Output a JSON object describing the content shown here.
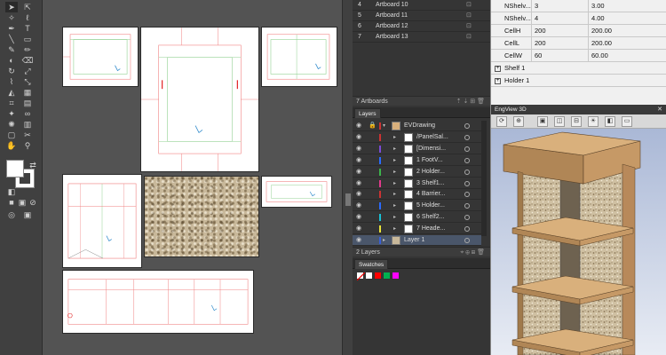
{
  "tools": {
    "icons": [
      "selection-arrow",
      "direct-select-arrow",
      "magic-wand",
      "lasso",
      "pen",
      "type",
      "line",
      "rectangle",
      "paintbrush",
      "pencil",
      "blob-brush",
      "eraser",
      "rotate",
      "scale",
      "width",
      "free-transform",
      "shape-builder",
      "perspective-grid",
      "mesh",
      "gradient",
      "eyedropper",
      "blend",
      "symbol-sprayer",
      "column-graph",
      "artboard",
      "slice",
      "hand",
      "zoom"
    ]
  },
  "artboards_panel": {
    "rows": [
      {
        "num": "4",
        "name": "Artboard 10"
      },
      {
        "num": "5",
        "name": "Artboard 11"
      },
      {
        "num": "6",
        "name": "Artboard 12"
      },
      {
        "num": "7",
        "name": "Artboard 13"
      }
    ],
    "footer": "7 Artboards"
  },
  "layers_panel": {
    "tab": "Layers",
    "rows": [
      {
        "name": "EVDrawing",
        "color": "#cc3333",
        "indent": 0,
        "expanded": true
      },
      {
        "name": "/PanelSal...",
        "color": "#cc3333",
        "indent": 1
      },
      {
        "name": "[Dimensi...",
        "color": "#7a4bd6",
        "indent": 1
      },
      {
        "name": "1 FootV...",
        "color": "#2a6bff",
        "indent": 1
      },
      {
        "name": "2 Holder...",
        "color": "#3cb44b",
        "indent": 1
      },
      {
        "name": "3 Shelf1...",
        "color": "#e23a8c",
        "indent": 1
      },
      {
        "name": "4 Barrier...",
        "color": "#cc3333",
        "indent": 1
      },
      {
        "name": "5 Holder...",
        "color": "#2a6bff",
        "indent": 1
      },
      {
        "name": "6 Shelf2...",
        "color": "#19c1d6",
        "indent": 1
      },
      {
        "name": "7 Heade...",
        "color": "#e8e23a",
        "indent": 1
      },
      {
        "name": "Layer 1",
        "color": "#3a5fd6",
        "indent": 0,
        "selected": true
      }
    ],
    "footer": "2 Layers"
  },
  "swatches_panel": {
    "tab": "Swatches",
    "colors": [
      "#ffffff",
      "#ff0000",
      "#00b050",
      "#ff00ff"
    ]
  },
  "properties": {
    "rows": [
      {
        "name": "NShelv...",
        "value": "3",
        "computed": "3.00"
      },
      {
        "name": "NShelv...",
        "value": "4",
        "computed": "4.00"
      },
      {
        "name": "CellH",
        "value": "200",
        "computed": "200.00"
      },
      {
        "name": "CellL",
        "value": "200",
        "computed": "200.00"
      },
      {
        "name": "CellW",
        "value": "60",
        "computed": "60.00"
      }
    ],
    "groups": [
      "Shelf 1",
      "Holder 1"
    ]
  },
  "engview": {
    "title": "EngView 3D",
    "toolbar_icons": [
      "orbit-icon",
      "zoom-fit-icon",
      "view-front-icon",
      "view-side-icon",
      "view-top-icon",
      "light-icon",
      "fold-icon",
      "flat-icon"
    ]
  }
}
